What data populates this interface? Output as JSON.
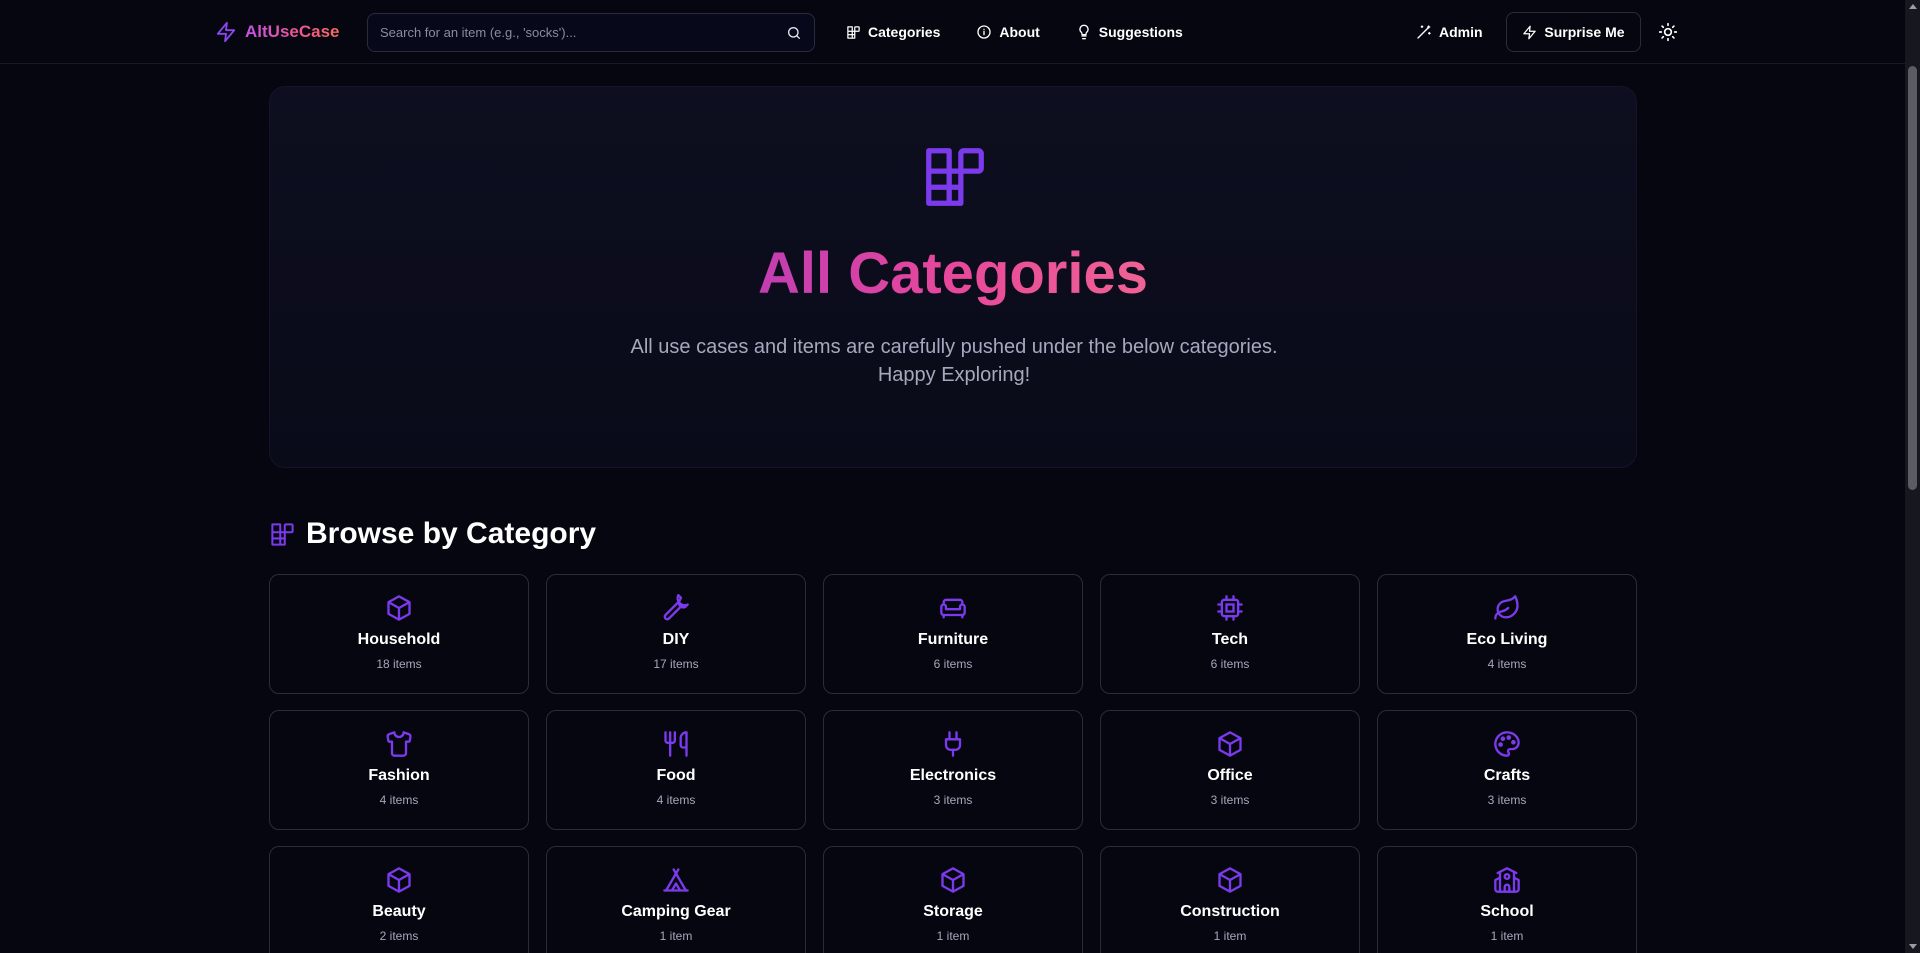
{
  "header": {
    "logo_text": "AltUseCase",
    "search_placeholder": "Search for an item (e.g., 'socks')...",
    "nav": [
      {
        "label": "Categories",
        "icon": "categories-icon"
      },
      {
        "label": "About",
        "icon": "info-icon"
      },
      {
        "label": "Suggestions",
        "icon": "lightbulb-icon"
      }
    ],
    "admin_label": "Admin",
    "surprise_label": "Surprise Me"
  },
  "hero": {
    "title": "All Categories",
    "description": "All use cases and items are carefully pushed under the below categories. Happy Exploring!"
  },
  "browse": {
    "title": "Browse by Category"
  },
  "categories": [
    {
      "name": "Household",
      "count": "18 items",
      "icon": "box-icon"
    },
    {
      "name": "DIY",
      "count": "17 items",
      "icon": "wrench-icon"
    },
    {
      "name": "Furniture",
      "count": "6 items",
      "icon": "sofa-icon"
    },
    {
      "name": "Tech",
      "count": "6 items",
      "icon": "cpu-icon"
    },
    {
      "name": "Eco Living",
      "count": "4 items",
      "icon": "leaf-icon"
    },
    {
      "name": "Fashion",
      "count": "4 items",
      "icon": "shirt-icon"
    },
    {
      "name": "Food",
      "count": "4 items",
      "icon": "utensils-icon"
    },
    {
      "name": "Electronics",
      "count": "3 items",
      "icon": "plug-icon"
    },
    {
      "name": "Office",
      "count": "3 items",
      "icon": "box-icon"
    },
    {
      "name": "Crafts",
      "count": "3 items",
      "icon": "palette-icon"
    },
    {
      "name": "Beauty",
      "count": "2 items",
      "icon": "box-icon"
    },
    {
      "name": "Camping Gear",
      "count": "1 item",
      "icon": "tent-icon"
    },
    {
      "name": "Storage",
      "count": "1 item",
      "icon": "box-icon"
    },
    {
      "name": "Construction",
      "count": "1 item",
      "icon": "box-icon"
    },
    {
      "name": "School",
      "count": "1 item",
      "icon": "school-icon"
    }
  ],
  "colors": {
    "accent": "#7c3aed",
    "brand_gradient_start": "#c452e6",
    "brand_gradient_end": "#f26d5b",
    "background": "#05060f",
    "card_border": "#2a2c3d"
  }
}
